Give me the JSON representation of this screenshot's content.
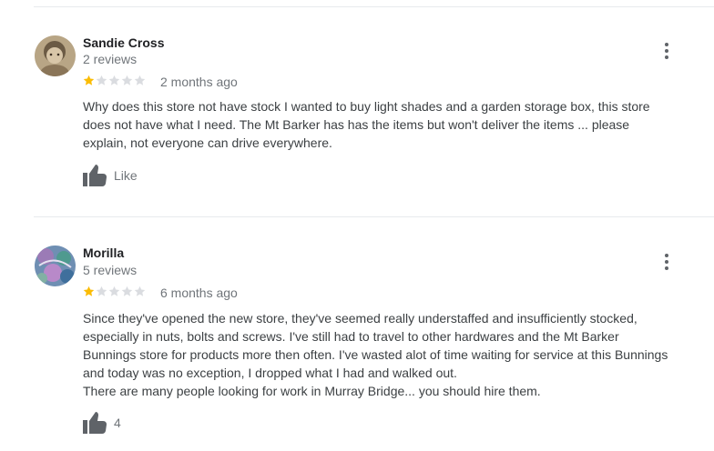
{
  "reviews": [
    {
      "author": "Sandie Cross",
      "review_count": "2 reviews",
      "rating": 1,
      "max_rating": 5,
      "date": "2 months ago",
      "text": "Why does this store not have stock I wanted to buy light shades and a garden storage box, this store\ndoes not have what I need. The Mt Barker has has the items but won't deliver the items ... please\nexplain, not everyone can drive everywhere.",
      "like_label": "Like",
      "avatar_icon": "photo-avatar"
    },
    {
      "author": "Morilla",
      "review_count": "5 reviews",
      "rating": 1,
      "max_rating": 5,
      "date": "6 months ago",
      "text": "Since they've opened the new store, they've seemed really understaffed and insufficiently stocked,\nespecially in nuts, bolts and screws. I've still had to travel to other hardwares and the Mt Barker\nBunnings store for products more then often. I've wasted alot of time waiting for service at this Bunnings\nand today was no exception, I dropped what I had and walked out.\nThere are many people looking for work in Murray Bridge... you should hire them.",
      "like_label": "4",
      "avatar_icon": "photo-avatar"
    }
  ],
  "colors": {
    "star_filled": "#fbbc04",
    "star_empty": "#dadce0",
    "secondary_text": "#70757a",
    "icon": "#5f6368"
  },
  "icons": {
    "menu": "more-vert-icon",
    "like": "thumb-up-icon",
    "star": "star-icon"
  }
}
